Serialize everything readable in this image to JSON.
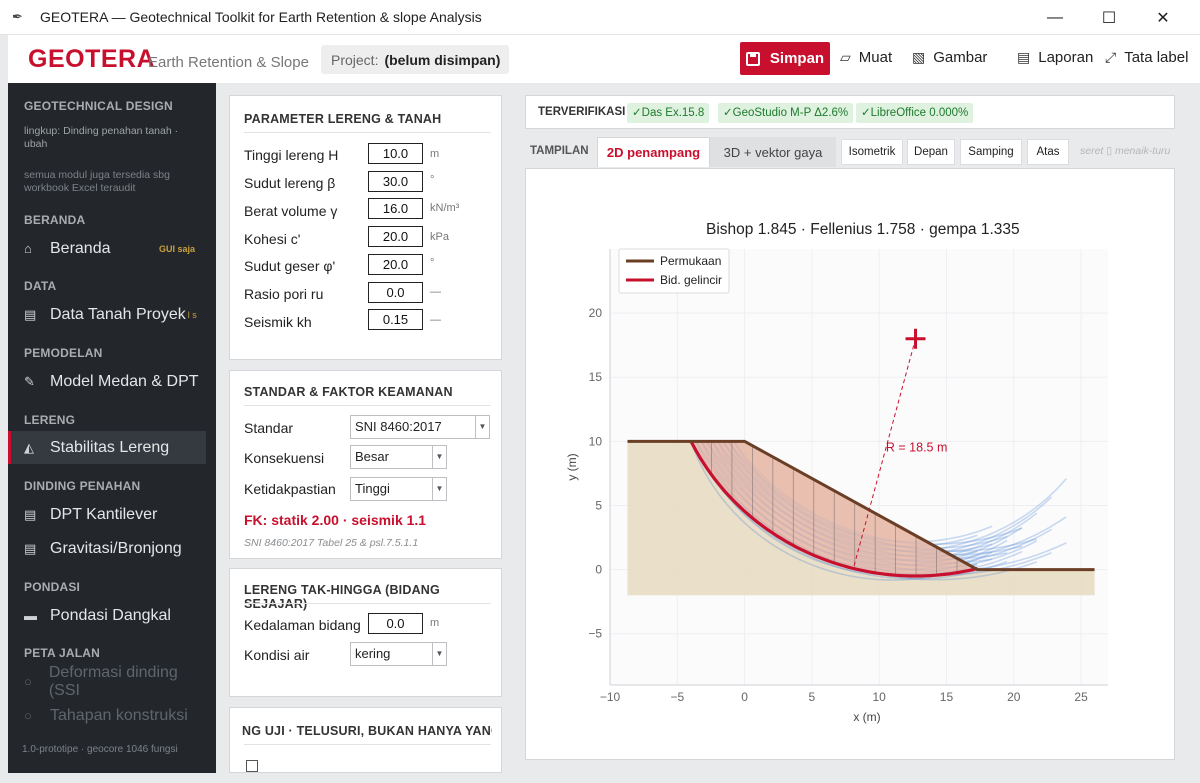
{
  "window": {
    "title": "GEOTERA — Geotechnical Toolkit for Earth Retention & slope Analysis"
  },
  "header": {
    "brand": "GEOTERA",
    "brand_sub": "Earth Retention & Slope",
    "project_label": "Project:",
    "project_value": "(belum disimpan)",
    "save_label": "Simpan",
    "open_label": "Muat",
    "image_label": "Gambar",
    "report_label": "Laporan",
    "labels_label": "Tata label"
  },
  "sidebar": {
    "section_design": "GEOTECHNICAL DESIGN",
    "scope_1": "lingkup: Dinding penahan tanah  ·",
    "scope_2": "ubah",
    "note_1": "semua modul juga tersedia sbg",
    "note_2": "workbook Excel teraudit",
    "group_home": "BERANDA",
    "item_home": "Beranda",
    "badge_gui": "GUI saja",
    "group_data": "DATA",
    "item_data": "Data Tanah Proyek",
    "item_data_suffix": "l s",
    "group_model": "PEMODELAN",
    "item_model": "Model Medan & DPT",
    "group_slope": "LERENG",
    "item_slope": "Stabilitas Lereng",
    "group_wall": "DINDING PENAHAN",
    "item_cant": "DPT Kantilever",
    "item_grav": "Gravitasi/Bronjong",
    "group_found": "PONDASI",
    "item_found": "Pondasi Dangkal",
    "group_road": "PETA JALAN",
    "item_deform": "Deformasi dinding (SSI",
    "item_stage": "Tahapan konstruksi",
    "footer": "1.0-prototipe · geocore 1046 fungsi"
  },
  "params": {
    "title": "PARAMETER LERENG & TANAH",
    "rows": [
      {
        "label": "Tinggi lereng H",
        "value": "10.0",
        "unit": "m"
      },
      {
        "label": "Sudut lereng β",
        "value": "30.0",
        "unit": "°"
      },
      {
        "label": "Berat volume γ",
        "value": "16.0",
        "unit": "kN/m³"
      },
      {
        "label": "Kohesi c'",
        "value": "20.0",
        "unit": "kPa"
      },
      {
        "label": "Sudut geser φ'",
        "value": "20.0",
        "unit": "°"
      },
      {
        "label": "Rasio pori ru",
        "value": "0.0",
        "unit": "—"
      },
      {
        "label": "Seismik kh",
        "value": "0.15",
        "unit": "—"
      }
    ]
  },
  "standard": {
    "title": "STANDAR & FAKTOR KEAMANAN",
    "std_label": "Standar",
    "std_value": "SNI 8460:2017",
    "cons_label": "Konsekuensi",
    "cons_value": "Besar",
    "unc_label": "Ketidakpastian",
    "unc_value": "Tinggi",
    "fk": "FK: statik 2.00 · seismik 1.1",
    "ref": "SNI 8460:2017 Tabel 25 & psl.7.5.1.1"
  },
  "infinite": {
    "title": "LERENG TAK-HINGGA (BIDANG SEJAJAR)",
    "depth_label": "Kedalaman bidang",
    "depth_value": "0.0",
    "depth_unit": "m",
    "water_label": "Kondisi air",
    "water_value": "kering"
  },
  "test_panel": {
    "title": "NG UJI  ·  TELUSURI, BUKAN HANYA YANG K"
  },
  "verify": {
    "label": "TERVERIFIKASI",
    "badges": [
      "✓Das Ex.15.8",
      "✓GeoStudio M-P Δ2.6%",
      "✓LibreOffice 0.000%"
    ]
  },
  "view": {
    "label": "TAMPILAN",
    "tab_2d": "2D penampang",
    "tab_3d": "3D + vektor gaya",
    "iso": "Isometrik",
    "front": "Depan",
    "side": "Samping",
    "top": "Atas",
    "hint": "seret ▯ menaik-turu"
  },
  "chart_data": {
    "type": "line",
    "title": "Bishop 1.845 · Fellenius 1.758 · gempa 1.335",
    "xlabel": "x (m)",
    "ylabel": "y (m)",
    "xlim": [
      -10,
      27
    ],
    "ylim": [
      -9,
      25
    ],
    "xticks": [
      -10,
      -5,
      0,
      5,
      10,
      15,
      20,
      25
    ],
    "yticks": [
      -5,
      0,
      5,
      10,
      15,
      20
    ],
    "legend_position": "top-left",
    "series": [
      {
        "name": "Permukaan",
        "color": "#6b3e26",
        "x": [
          -8.7,
          0,
          17.3,
          26
        ],
        "y": [
          10,
          10,
          0,
          0
        ]
      },
      {
        "name": "Bid. gelincir",
        "color": "#c8102e",
        "center": [
          12.7,
          18
        ],
        "radius": 18.5
      }
    ],
    "ground_base_y": -2,
    "center_marker": [
      12.7,
      18
    ],
    "annotation": "R = 18.5 m",
    "colors": {
      "accent": "#c8102e",
      "slice_fill": "#e8b5a8",
      "soil": "#e8dcc2",
      "trial": "#5b8fd6"
    }
  }
}
